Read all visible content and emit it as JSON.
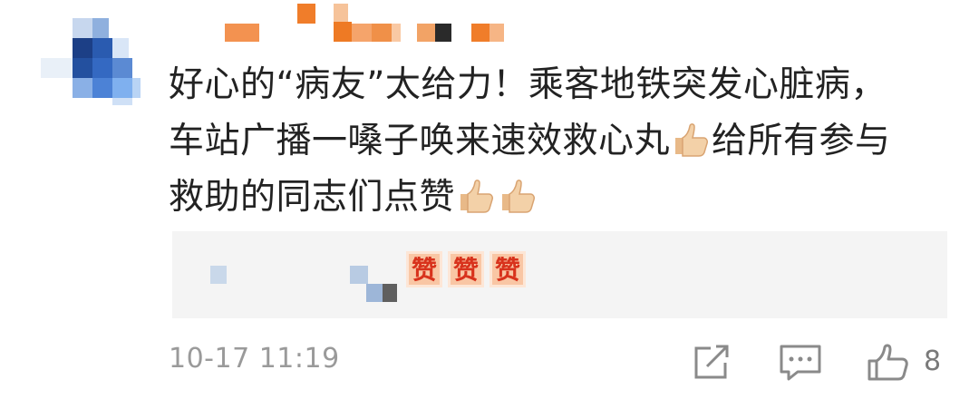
{
  "comment": {
    "text_line1": "好心的“病友”太给力！乘客地铁突发心脏病，",
    "text_line2a": "车站广播一嗓子唤来速效救心丸",
    "text_line2b": "给所有参与",
    "text_line3": "救助的同志们点赞",
    "emoji": "thumbs-up-icon"
  },
  "reply": {
    "sticker_label": "赞",
    "sticker_count": 3
  },
  "footer": {
    "timestamp": "10-17 11:19",
    "like_count": "8"
  },
  "colors": {
    "text": "#222222",
    "muted": "#9a9a9a",
    "icon": "#8a8a8a",
    "reply_bg": "#f4f4f4",
    "mosaic_orange": "#f07d2a",
    "mosaic_blue": "#1f4f9e"
  }
}
